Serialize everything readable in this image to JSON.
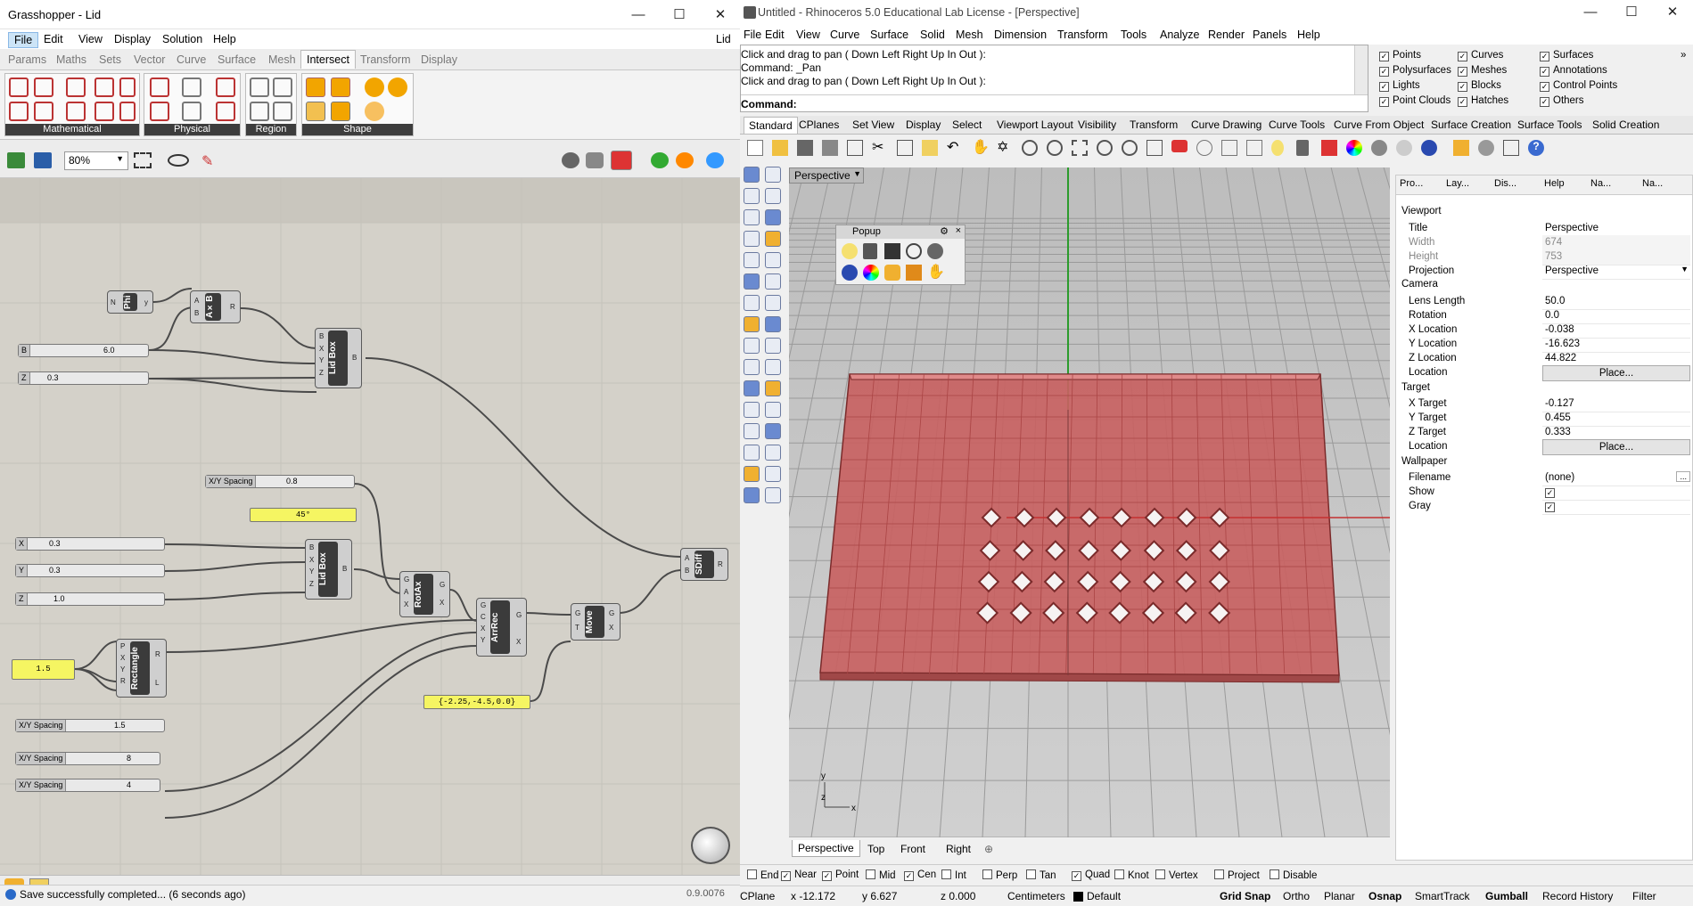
{
  "grasshopper": {
    "title": "Grasshopper - Lid",
    "doc_name": "Lid",
    "menu": [
      "File",
      "Edit",
      "View",
      "Display",
      "Solution",
      "Help"
    ],
    "tabs": [
      "Params",
      "Maths",
      "Sets",
      "Vector",
      "Curve",
      "Surface",
      "Mesh",
      "Intersect",
      "Transform",
      "Display"
    ],
    "active_tab": "Intersect",
    "ribbon_groups": [
      "Mathematical",
      "Physical",
      "Region",
      "Shape"
    ],
    "zoom": "80%",
    "components": {
      "phi": "Phi",
      "axb": "A×B",
      "lidbox1": "Lid Box",
      "lidbox2": "Lid Box",
      "rotax": "RotAx",
      "arrrec": "ArrRec",
      "move": "Move",
      "sdiff": "SDiff",
      "rectangle": "Rectangle"
    },
    "sliders": {
      "b": {
        "label": "B",
        "value": "6.0"
      },
      "z1": {
        "label": "Z",
        "value": "0.3"
      },
      "xyspacing1": {
        "label": "X/Y Spacing",
        "value": "0.8"
      },
      "x": {
        "label": "X",
        "value": "0.3"
      },
      "y": {
        "label": "Y",
        "value": "0.3"
      },
      "z2": {
        "label": "Z",
        "value": "1.0"
      },
      "xyspacing2": {
        "label": "X/Y Spacing",
        "value": "1.5"
      },
      "xyspacing3": {
        "label": "X/Y Spacing",
        "value": "8"
      },
      "xyspacing4": {
        "label": "X/Y Spacing",
        "value": "4"
      }
    },
    "panels": {
      "angle": "45°",
      "size": "1.5",
      "vector": "{-2.25,-4.5,0.0}"
    },
    "status": "Save successfully completed... (6 seconds ago)",
    "version": "0.9.0076"
  },
  "rhino": {
    "title": "Untitled - Rhinoceros 5.0 Educational Lab License - [Perspective]",
    "menu": [
      "File",
      "Edit",
      "View",
      "Curve",
      "Surface",
      "Solid",
      "Mesh",
      "Dimension",
      "Transform",
      "Tools",
      "Analyze",
      "Render",
      "Panels",
      "Help"
    ],
    "command_history": [
      "Click and drag to pan ( Down  Left  Right  Up  In  Out ):",
      "Command: _Pan",
      "Click and drag to pan ( Down  Left  Right  Up  In  Out ):"
    ],
    "command_prompt": "Command:",
    "filters": [
      {
        "label": "Points",
        "checked": true
      },
      {
        "label": "Curves",
        "checked": true
      },
      {
        "label": "Surfaces",
        "checked": true
      },
      {
        "label": "Polysurfaces",
        "checked": true
      },
      {
        "label": "Meshes",
        "checked": true
      },
      {
        "label": "Annotations",
        "checked": true
      },
      {
        "label": "Lights",
        "checked": true
      },
      {
        "label": "Blocks",
        "checked": true
      },
      {
        "label": "Control Points",
        "checked": true
      },
      {
        "label": "Point Clouds",
        "checked": true
      },
      {
        "label": "Hatches",
        "checked": true
      },
      {
        "label": "Others",
        "checked": true
      }
    ],
    "toolbar_tabs": [
      "Standard",
      "CPlanes",
      "Set View",
      "Display",
      "Select",
      "Viewport Layout",
      "Visibility",
      "Transform",
      "Curve Drawing",
      "Curve Tools",
      "Curve From Object",
      "Surface Creation",
      "Surface Tools",
      "Solid Creation"
    ],
    "viewport_title": "Perspective",
    "popup_title": "Popup",
    "axis_labels": {
      "y": "y",
      "z": "z",
      "x": "x"
    },
    "viewport_tabs": [
      "Perspective",
      "Top",
      "Front",
      "Right"
    ],
    "panel_tabs": [
      "Pro...",
      "Lay...",
      "Dis...",
      "Help",
      "Na...",
      "Na..."
    ],
    "properties": {
      "viewport_section": "Viewport",
      "title_k": "Title",
      "title_v": "Perspective",
      "width_k": "Width",
      "width_v": "674",
      "height_k": "Height",
      "height_v": "753",
      "projection_k": "Projection",
      "projection_v": "Perspective",
      "camera_section": "Camera",
      "lens_k": "Lens Length",
      "lens_v": "50.0",
      "rotation_k": "Rotation",
      "rotation_v": "0.0",
      "xloc_k": "X Location",
      "xloc_v": "-0.038",
      "yloc_k": "Y Location",
      "yloc_v": "-16.623",
      "zloc_k": "Z Location",
      "zloc_v": "44.822",
      "loc_k": "Location",
      "place_btn": "Place...",
      "target_section": "Target",
      "xt_k": "X Target",
      "xt_v": "-0.127",
      "yt_k": "Y Target",
      "yt_v": "0.455",
      "zt_k": "Z Target",
      "zt_v": "0.333",
      "tloc_k": "Location",
      "wallpaper_section": "Wallpaper",
      "filename_k": "Filename",
      "filename_v": "(none)",
      "show_k": "Show",
      "gray_k": "Gray"
    },
    "osnaps": [
      {
        "label": "End",
        "checked": false
      },
      {
        "label": "Near",
        "checked": true
      },
      {
        "label": "Point",
        "checked": true
      },
      {
        "label": "Mid",
        "checked": false
      },
      {
        "label": "Cen",
        "checked": true
      },
      {
        "label": "Int",
        "checked": false
      },
      {
        "label": "Perp",
        "checked": false
      },
      {
        "label": "Tan",
        "checked": false
      },
      {
        "label": "Quad",
        "checked": true
      },
      {
        "label": "Knot",
        "checked": false
      },
      {
        "label": "Vertex",
        "checked": false
      },
      {
        "label": "Project",
        "checked": false
      },
      {
        "label": "Disable",
        "checked": false
      }
    ],
    "status": {
      "cplane": "CPlane",
      "x": "x -12.172",
      "y": "y 6.627",
      "z": "z 0.000",
      "units": "Centimeters",
      "layer": "Default",
      "grid_snap": "Grid Snap",
      "ortho": "Ortho",
      "planar": "Planar",
      "osnap": "Osnap",
      "smarttrack": "SmartTrack",
      "gumball": "Gumball",
      "record_history": "Record History",
      "filter": "Filter"
    },
    "colors": {
      "box": "#c86262",
      "accent": "#0078d7"
    }
  }
}
